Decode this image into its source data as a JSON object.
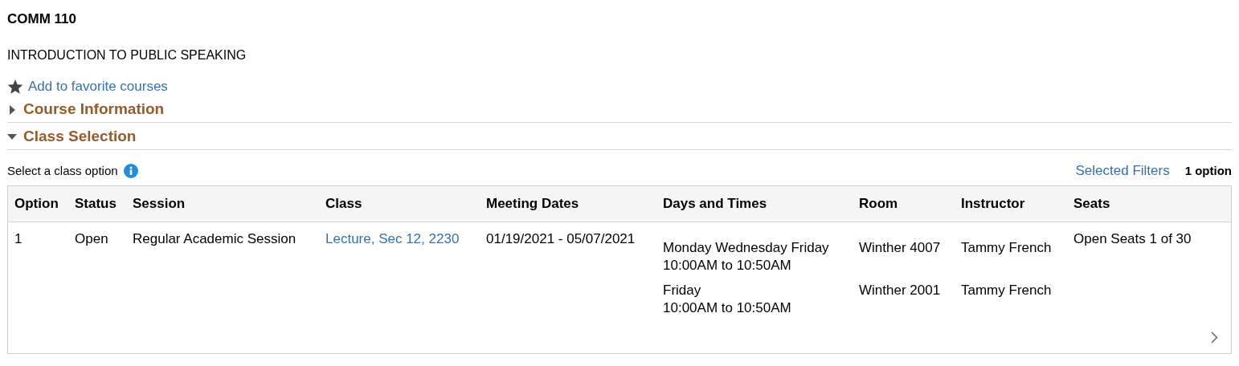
{
  "course": {
    "code": "COMM 110",
    "title": "INTRODUCTION TO PUBLIC SPEAKING"
  },
  "favorite_link": "Add to favorite courses",
  "sections": [
    {
      "label": "Course Information",
      "expanded": false
    },
    {
      "label": "Class Selection",
      "expanded": true
    }
  ],
  "class_selection": {
    "prompt": "Select a class option",
    "filters_link": "Selected Filters",
    "option_count": "1 option"
  },
  "table": {
    "columns": [
      "Option",
      "Status",
      "Session",
      "Class",
      "Meeting Dates",
      "Days and Times",
      "Room",
      "Instructor",
      "Seats"
    ],
    "rows": [
      {
        "option": "1",
        "status": "Open",
        "session": "Regular Academic Session",
        "class": "Lecture, Sec 12, 2230",
        "meeting_dates": "01/19/2021 - 05/07/2021",
        "seats": "Open Seats 1 of 30",
        "meetings": [
          {
            "days": "Monday Wednesday Friday",
            "times": "10:00AM to 10:50AM",
            "room": "Winther 4007",
            "instructor": "Tammy French"
          },
          {
            "days": "Friday",
            "times": "10:00AM to 10:50AM",
            "room": "Winther 2001",
            "instructor": "Tammy French"
          }
        ]
      }
    ]
  }
}
